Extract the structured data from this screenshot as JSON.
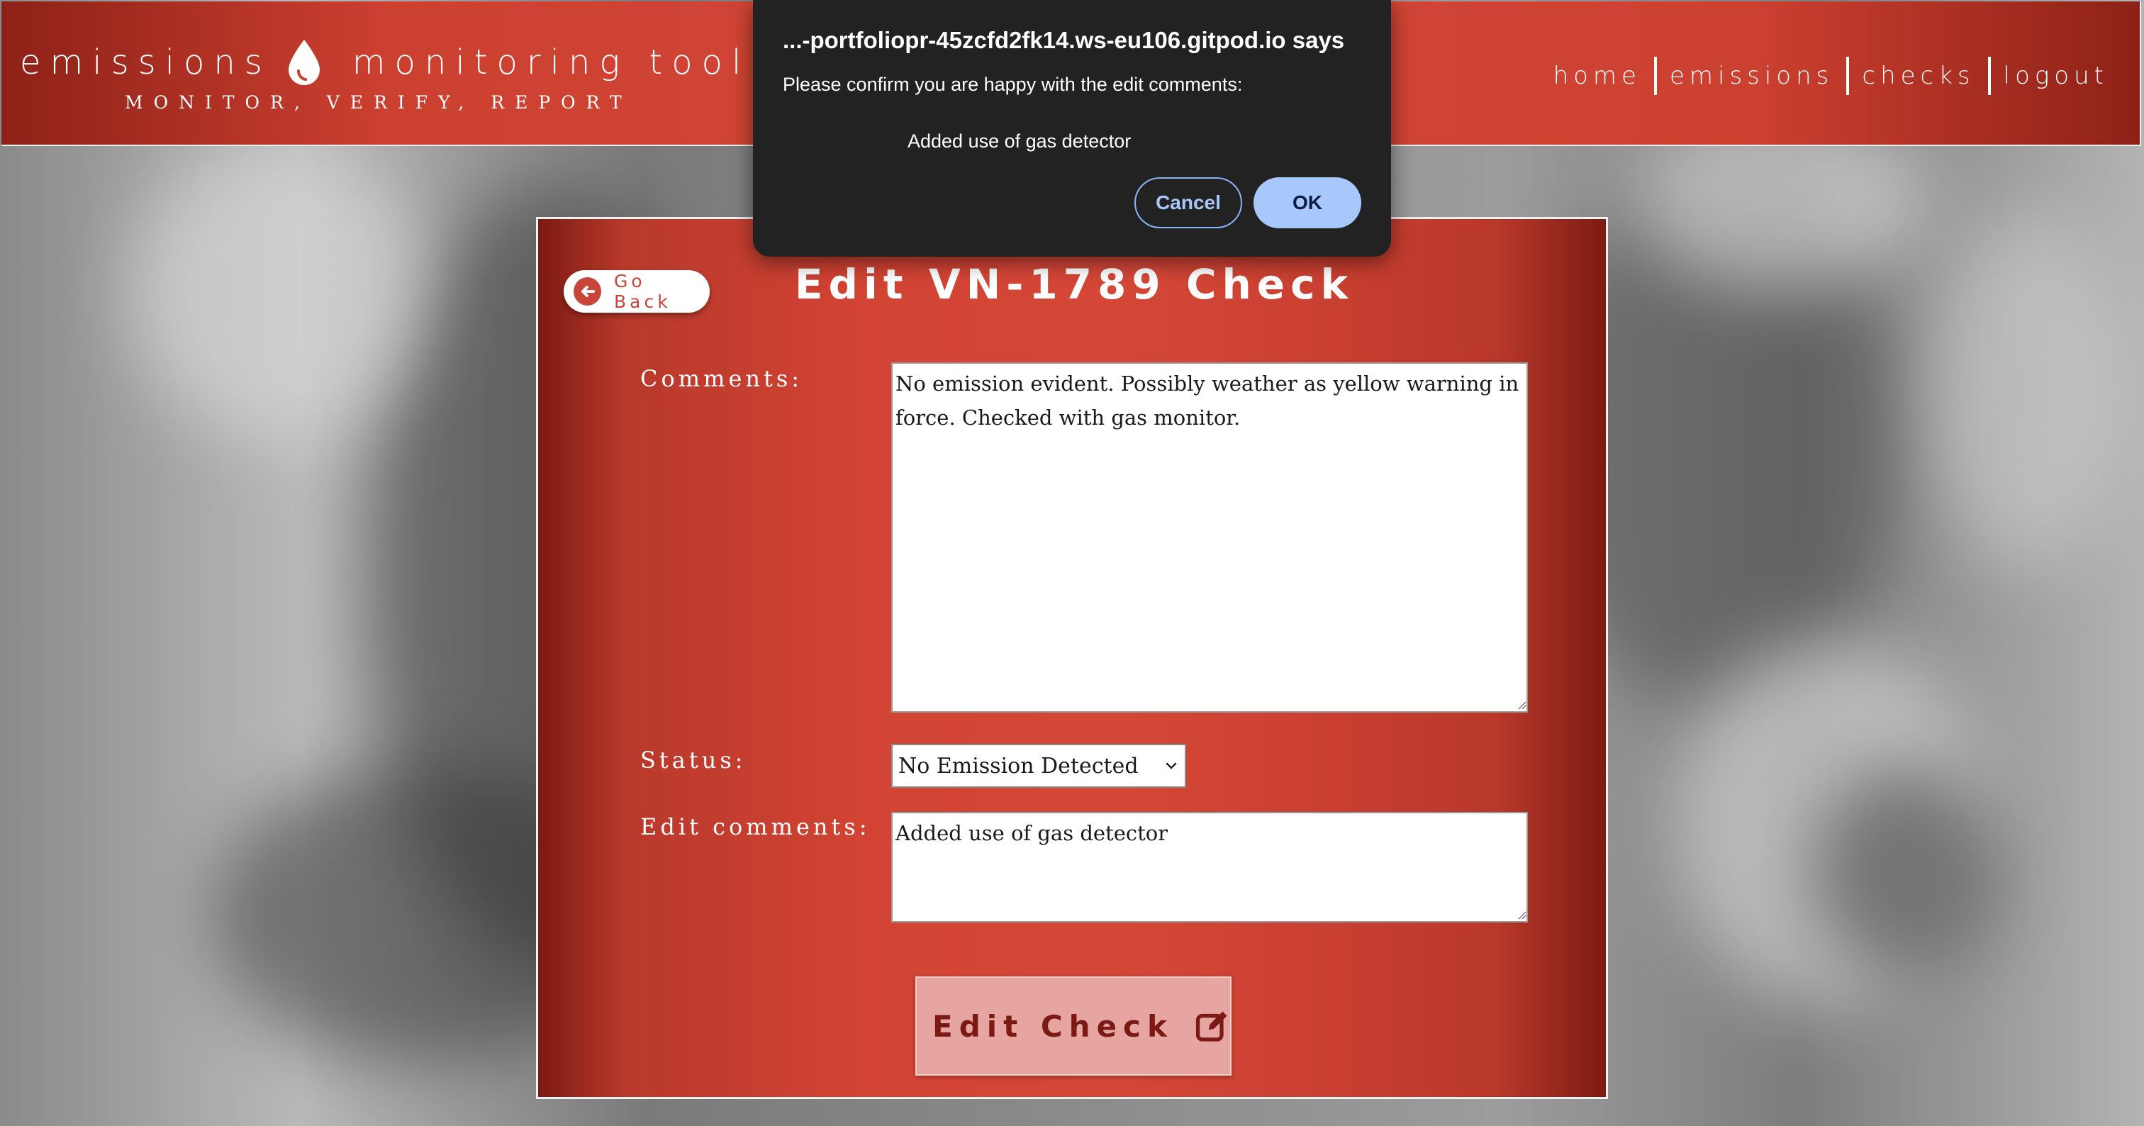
{
  "header": {
    "logo_text_left": "emissions",
    "logo_text_right": "monitoring tool",
    "logo_icon": "drop-icon",
    "tagline": "MONITOR, VERIFY, REPORT",
    "nav": [
      "home",
      "emissions",
      "checks",
      "logout"
    ]
  },
  "panel": {
    "go_back_label": "Go Back",
    "go_back_icon": "arrow-left-circle-icon",
    "title": "Edit VN-1789 Check",
    "comments_label": "Comments:",
    "comments_value": "No emission evident. Possibly weather as yellow warning in force. Checked with gas monitor.",
    "status_label": "Status:",
    "status_selected": "No Emission Detected",
    "edit_comments_label": "Edit comments:",
    "edit_comments_value": "Added use of gas detector",
    "submit_label": "Edit Check",
    "submit_icon": "edit-square-icon"
  },
  "dialog": {
    "origin": "...-portfoliopr-45zcfd2fk14.ws-eu106.gitpod.io says",
    "message": "Please confirm you are happy with the edit comments:",
    "value": "Added use of gas detector",
    "cancel_label": "Cancel",
    "ok_label": "OK"
  },
  "colors": {
    "brand_red": "#d24838",
    "brand_dark_red": "#8e2117",
    "button_pink": "#e6a5a0",
    "dialog_bg": "#222222",
    "dialog_accent": "#a8c7fa"
  }
}
